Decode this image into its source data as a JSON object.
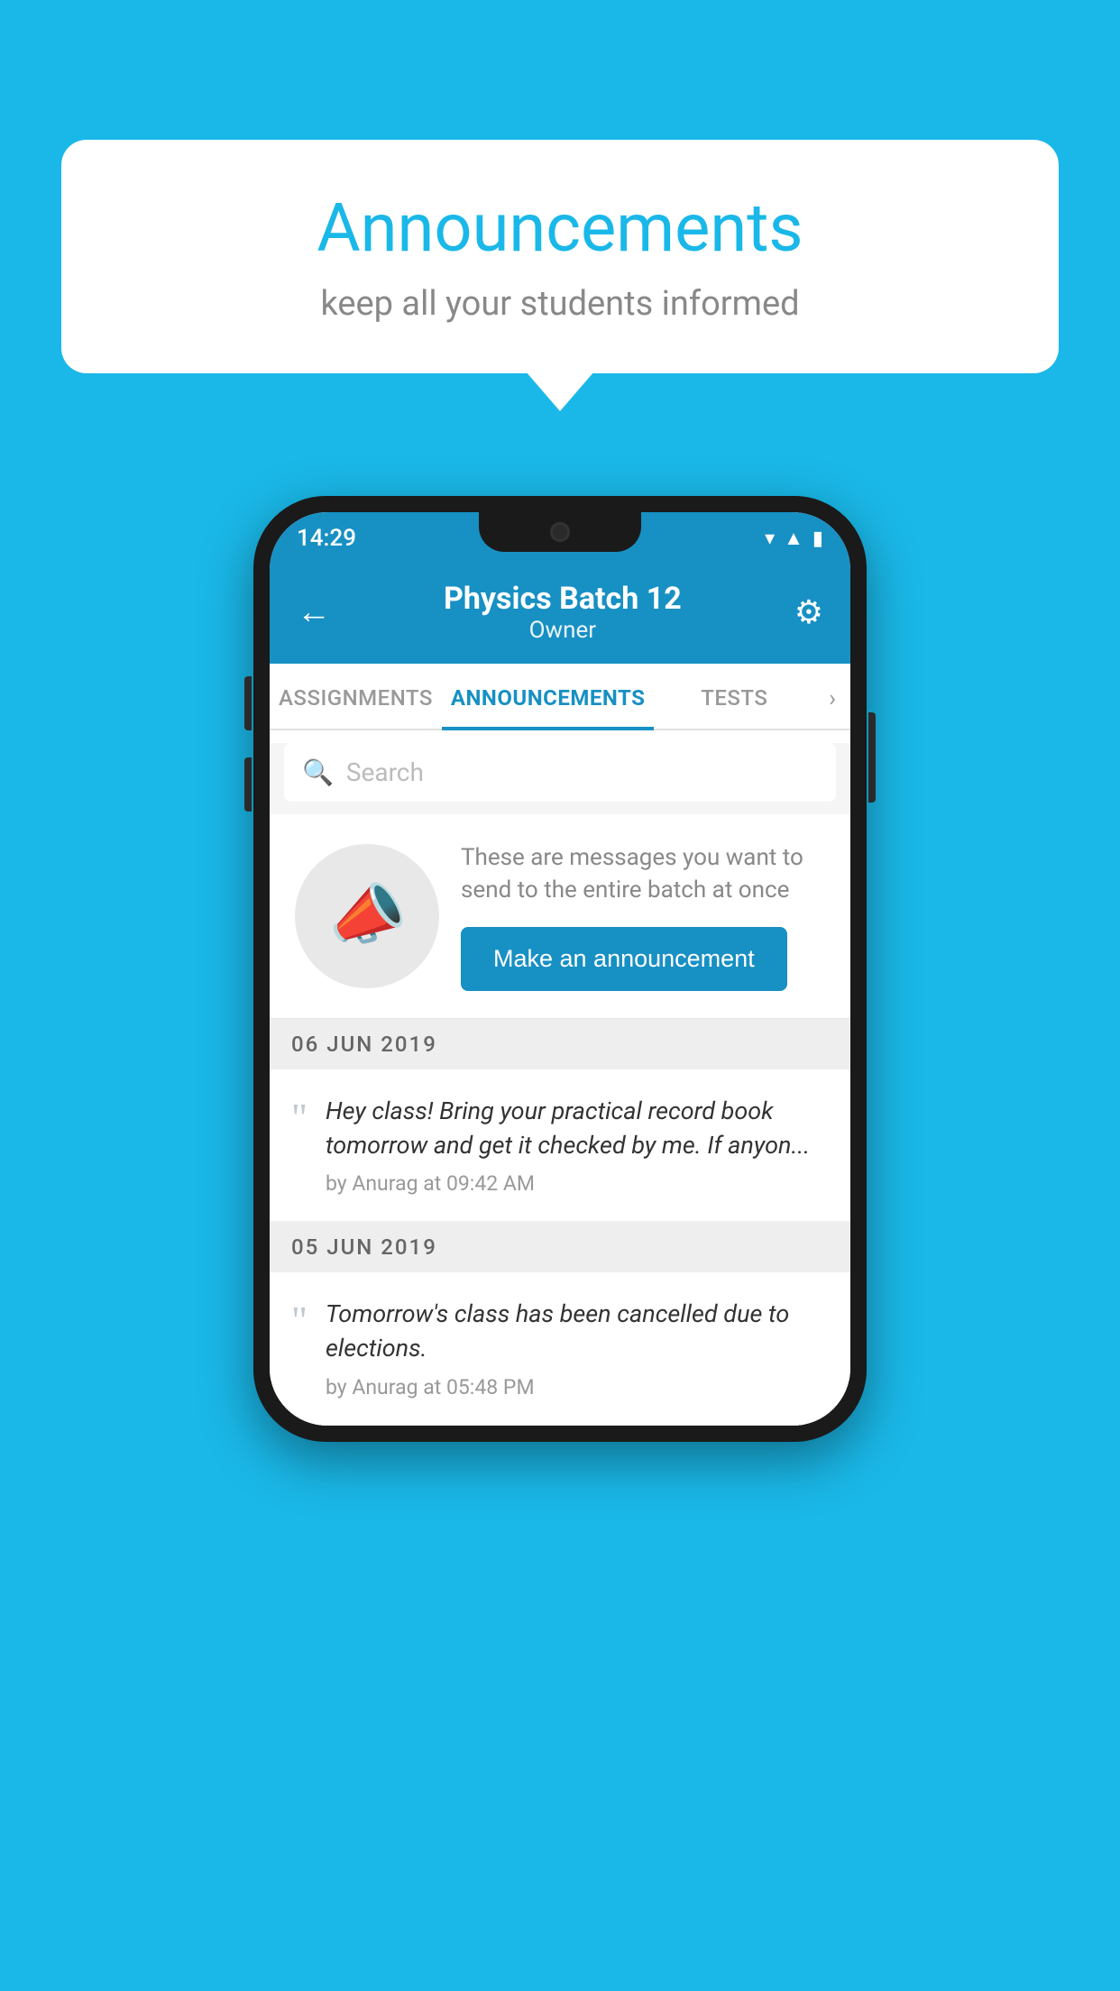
{
  "background_color": "#1ab8e8",
  "speech_bubble": {
    "title": "Announcements",
    "subtitle": "keep all your students informed"
  },
  "phone": {
    "status_bar": {
      "time": "14:29",
      "wifi": "▾",
      "signal": "▲",
      "battery": "▮"
    },
    "header": {
      "back_label": "←",
      "title": "Physics Batch 12",
      "subtitle": "Owner",
      "gear_label": "⚙"
    },
    "tabs": [
      {
        "label": "ASSIGNMENTS",
        "active": false
      },
      {
        "label": "ANNOUNCEMENTS",
        "active": true
      },
      {
        "label": "TESTS",
        "active": false
      }
    ],
    "tab_more": "›",
    "search": {
      "placeholder": "Search"
    },
    "promo_card": {
      "description": "These are messages you want to send to the entire batch at once",
      "button_label": "Make an announcement"
    },
    "announcements": [
      {
        "date": "06  JUN  2019",
        "text": "Hey class! Bring your practical record book tomorrow and get it checked by me. If anyon...",
        "meta": "by Anurag at 09:42 AM"
      },
      {
        "date": "05  JUN  2019",
        "text": "Tomorrow's class has been cancelled due to elections.",
        "meta": "by Anurag at 05:48 PM"
      }
    ]
  }
}
